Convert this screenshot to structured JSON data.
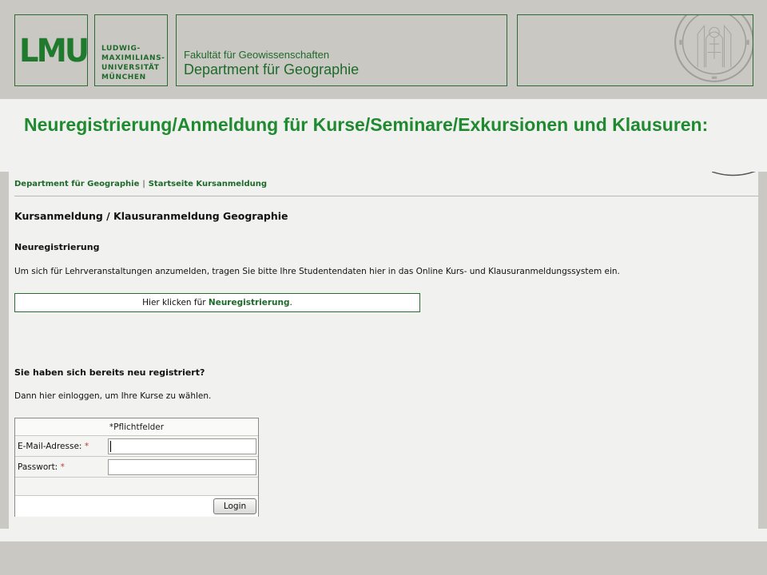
{
  "header": {
    "logo_text": "LMU",
    "university_lines": [
      "LUDWIG-",
      "MAXIMILIANS-",
      "UNIVERSITÄT",
      "MÜNCHEN"
    ],
    "faculty": "Fakultät für Geowissenschaften",
    "department": "Department für Geographie"
  },
  "slide_title": "Neuregistrierung/Anmeldung für Kurse/Seminare/Exkursionen und Klausuren:",
  "page": {
    "breadcrumb": {
      "home": "Department für Geographie",
      "separator": "|",
      "current": "Startseite Kursanmeldung"
    },
    "heading": "Kursanmeldung / Klausuranmeldung Geographie",
    "section_register": "Neuregistrierung",
    "intro_text": "Um sich für Lehrveranstaltungen anzumelden, tragen Sie bitte Ihre Studentendaten hier in das Online Kurs- und Klausuranmeldungssystem ein.",
    "register_prefix": "Hier klicken für ",
    "register_link": "Neuregistrierung",
    "register_suffix": ".",
    "section_login": "Sie haben sich bereits neu registriert?",
    "login_intro": "Dann hier einloggen, um Ihre Kurse zu wählen.",
    "login": {
      "required_note": "*Pflichtfelder",
      "email_label": "E-Mail-Adresse:",
      "password_label": "Passwort:",
      "required_marker": "*",
      "email_value": "",
      "password_value": "",
      "button_label": "Login"
    }
  },
  "colors": {
    "brand_green": "#1f8a2f",
    "dark_green": "#1f6a2b",
    "header_bg": "#c9c8c2",
    "content_bg": "#f1f1ef",
    "required_red": "#c0392b"
  }
}
